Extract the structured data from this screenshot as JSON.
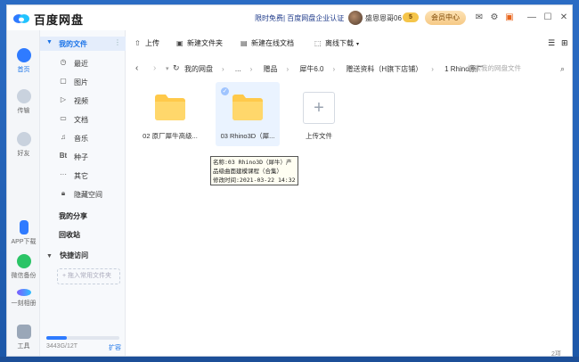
{
  "window": {
    "app_name": "百度网盘",
    "promo_text": "限时免费| 百度网盘企业认证",
    "username": "盛恩恩哥06",
    "vip_badge": "5",
    "vip_button": "会员中心"
  },
  "rail": {
    "items": [
      {
        "label": "首页",
        "icon": "cloud-icon"
      },
      {
        "label": "传输",
        "icon": "transfer-icon"
      },
      {
        "label": "好友",
        "icon": "friends-icon"
      },
      {
        "label": "APP下载",
        "icon": "phone-icon"
      },
      {
        "label": "微信备份",
        "icon": "wechat-icon"
      },
      {
        "label": "一刻相册",
        "icon": "album-icon"
      },
      {
        "label": "工具",
        "icon": "tools-icon"
      }
    ]
  },
  "nav": {
    "my_files": "我的文件",
    "items": [
      {
        "label": "最近",
        "icon": "clock-icon"
      },
      {
        "label": "图片",
        "icon": "image-icon"
      },
      {
        "label": "视频",
        "icon": "video-icon"
      },
      {
        "label": "文档",
        "icon": "doc-icon"
      },
      {
        "label": "音乐",
        "icon": "music-icon"
      },
      {
        "label": "种子",
        "icon": "bt-icon"
      },
      {
        "label": "其它",
        "icon": "other-icon"
      },
      {
        "label": "隐藏空间",
        "icon": "lock-icon"
      }
    ],
    "my_share": "我的分享",
    "recycle": "回收站",
    "quick_access": "快捷访问",
    "drop_hint": "+ 拖入常用文件夹",
    "quota": "3443G/12T",
    "quota_fraction": 0.28,
    "expand": "扩容"
  },
  "toolbar": {
    "upload": "上传",
    "new_folder": "新建文件夹",
    "new_online_doc": "新建在线文档",
    "offline_download": "离线下载"
  },
  "breadcrumb": [
    "我的网盘",
    "...",
    "赠品",
    "犀牛6.0",
    "赠送资料（H旗下店铺）",
    "1 Rhino原厂"
  ],
  "search_placeholder": "搜索我的网盘文件",
  "files": [
    {
      "name": "02 原厂犀牛高级...",
      "selected": false
    },
    {
      "name": "03 Rhino3D（犀...",
      "selected": true
    }
  ],
  "upload_tile": "上传文件",
  "tooltip": {
    "line1": "名称:03 Rhino3D（犀牛）产",
    "line2": "品级曲面建模课程（合集）",
    "line3": "修改时间:2021-03-22 14:32"
  },
  "item_count": "2项"
}
